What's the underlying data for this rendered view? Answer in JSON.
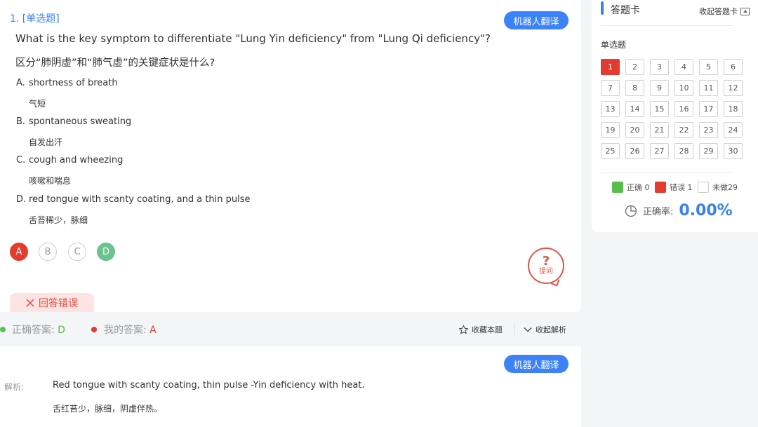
{
  "question": {
    "type_label": "1. [单选题]",
    "translate_label": "机器人翻译",
    "text_en": "What is the key symptom to differentiate \"Lung Yin deficiency\" from \"Lung Qi deficiency\"?",
    "text_zh": "区分“肺阴虚”和“肺气虚”的关键症状是什么?",
    "options": [
      {
        "letter": "A.",
        "en": "shortness of breath",
        "zh": "气短"
      },
      {
        "letter": "B.",
        "en": "spontaneous sweating",
        "zh": "自发出汗"
      },
      {
        "letter": "C.",
        "en": "cough and wheezing",
        "zh": "咳嗽和喘息"
      },
      {
        "letter": "D.",
        "en": "red tongue with scanty coating, and a thin pulse",
        "zh": "舌苔稀少，脉细"
      }
    ],
    "answer_circles": [
      {
        "letter": "A",
        "state": "selected-wrong"
      },
      {
        "letter": "B",
        "state": "none"
      },
      {
        "letter": "C",
        "state": "none"
      },
      {
        "letter": "D",
        "state": "correct"
      }
    ],
    "ask_label": "提问",
    "wrong_label": "回答错误"
  },
  "answer_bar": {
    "correct_label": "正确答案:",
    "correct_value": "D",
    "mine_label": "我的答案:",
    "mine_value": "A",
    "favorite_label": "收藏本题",
    "collapse_label": "收起解析"
  },
  "explanation": {
    "translate_label": "机器人翻译",
    "label": "解析:",
    "text_en": "Red tongue with scanty coating, thin pulse -Yin deficiency with heat.",
    "text_zh": "舌红苔少，脉细，阴虚伴热。"
  },
  "sheet": {
    "title": "答题卡",
    "collapse_label": "收起答题卡",
    "section": "单选题",
    "cells": [
      {
        "n": "1",
        "state": "wrong"
      },
      {
        "n": "2",
        "state": "none"
      },
      {
        "n": "3",
        "state": "none"
      },
      {
        "n": "4",
        "state": "none"
      },
      {
        "n": "5",
        "state": "none"
      },
      {
        "n": "6",
        "state": "none"
      },
      {
        "n": "7",
        "state": "none"
      },
      {
        "n": "8",
        "state": "none"
      },
      {
        "n": "9",
        "state": "none"
      },
      {
        "n": "10",
        "state": "none"
      },
      {
        "n": "11",
        "state": "none"
      },
      {
        "n": "12",
        "state": "none"
      },
      {
        "n": "13",
        "state": "none"
      },
      {
        "n": "14",
        "state": "none"
      },
      {
        "n": "15",
        "state": "none"
      },
      {
        "n": "16",
        "state": "none"
      },
      {
        "n": "17",
        "state": "none"
      },
      {
        "n": "18",
        "state": "none"
      },
      {
        "n": "19",
        "state": "none"
      },
      {
        "n": "20",
        "state": "none"
      },
      {
        "n": "21",
        "state": "none"
      },
      {
        "n": "22",
        "state": "none"
      },
      {
        "n": "23",
        "state": "none"
      },
      {
        "n": "24",
        "state": "none"
      },
      {
        "n": "25",
        "state": "none"
      },
      {
        "n": "26",
        "state": "none"
      },
      {
        "n": "27",
        "state": "none"
      },
      {
        "n": "28",
        "state": "none"
      },
      {
        "n": "29",
        "state": "none"
      },
      {
        "n": "30",
        "state": "none"
      }
    ],
    "legend": {
      "correct": "正确 0",
      "wrong": "错误 1",
      "undone": "未做29"
    },
    "rate_label": "正确率:",
    "rate_value": "0.00%"
  },
  "colors": {
    "accent": "#3b7ff6",
    "correct": "#5cbd4f",
    "wrong": "#e53a2f"
  },
  "icons": [
    "close-icon",
    "help-question-icon",
    "star-icon",
    "chevron-down-icon",
    "collapse-up-icon",
    "pie-chart-icon"
  ]
}
